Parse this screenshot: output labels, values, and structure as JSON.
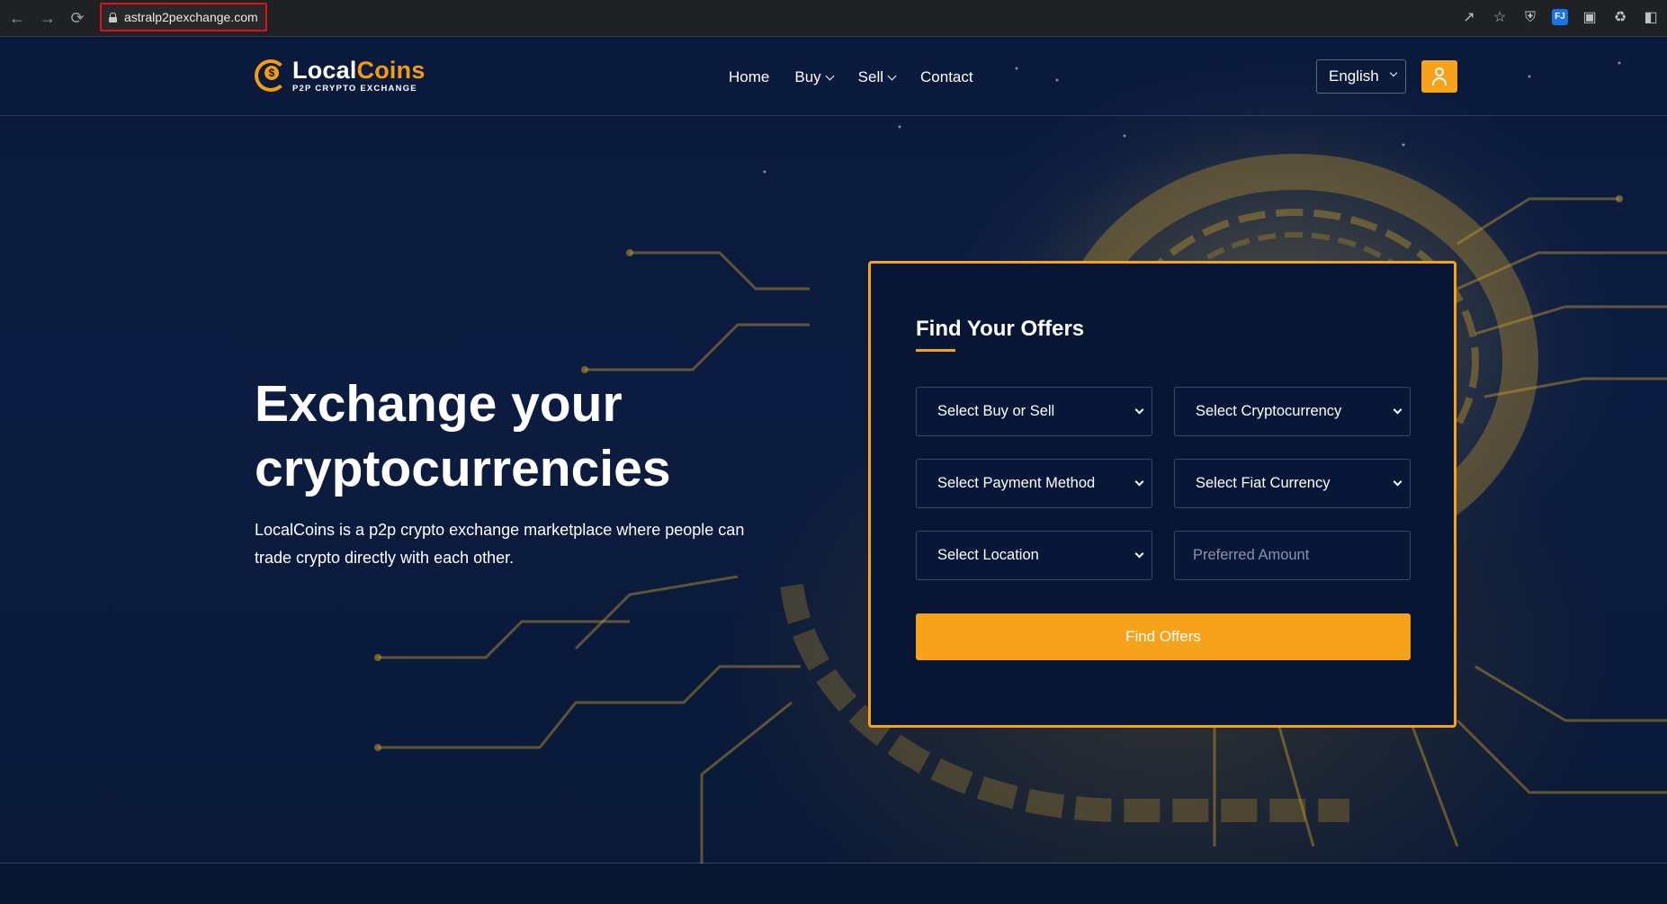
{
  "browser": {
    "url": "astralp2pexchange.com",
    "icons": [
      "back-arrow-icon",
      "forward-arrow-icon",
      "reload-icon",
      "lock-icon",
      "share-icon",
      "star-icon",
      "shield-extension-icon",
      "fj-extension-icon",
      "window-icon",
      "puzzle-icon",
      "sidebar-icon"
    ],
    "fj_label": "FJ"
  },
  "header": {
    "logo_main_white": "Local",
    "logo_main_orange": "Coins",
    "logo_sub": "P2P CRYPTO EXCHANGE",
    "nav": {
      "home": "Home",
      "buy": "Buy",
      "sell": "Sell",
      "contact": "Contact"
    },
    "language": "English"
  },
  "hero": {
    "title_line1": "Exchange your",
    "title_line2": "cryptocurrencies",
    "description": "LocalCoins is a p2p crypto exchange marketplace where people can trade crypto directly with each other."
  },
  "offers": {
    "title": "Find Your Offers",
    "buy_or_sell": "Select Buy or Sell",
    "cryptocurrency": "Select Cryptocurrency",
    "payment_method": "Select Payment Method",
    "fiat_currency": "Select Fiat Currency",
    "location": "Select Location",
    "amount_placeholder": "Preferred Amount",
    "button": "Find Offers"
  },
  "colors": {
    "accent": "#f7a21b",
    "background": "#0a1a3c",
    "address_highlight": "#e0101a"
  }
}
